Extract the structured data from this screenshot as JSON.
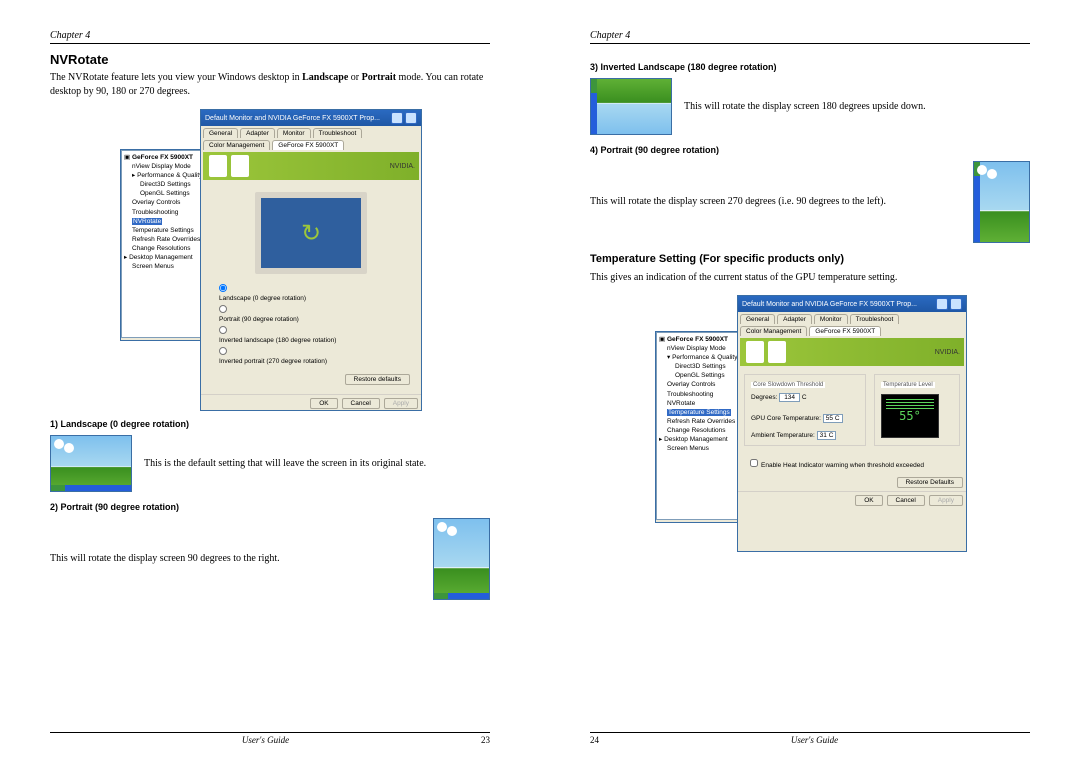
{
  "chapterLabel": "Chapter  4",
  "footerGuide": "User's Guide",
  "left": {
    "pageNum": "23",
    "h2": "NVRotate",
    "intro1a": "The NVRotate feature lets you view your Windows desktop in ",
    "intro1b": "Landscape",
    "intro1c": " or ",
    "intro2a": "Portrait",
    "intro2b": " mode. You can rotate desktop by 90, 180 or 270 degrees.",
    "winTitle": "Default Monitor and NVIDIA GeForce FX 5900XT Prop...",
    "tabs": {
      "general": "General",
      "adapter": "Adapter",
      "monitor": "Monitor",
      "troubleshoot": "Troubleshoot",
      "color": "Color Management",
      "gf": "GeForce FX 5900XT"
    },
    "nvLogo": "NVIDIA.",
    "tree": {
      "root": "GeForce FX 5900XT",
      "i1": "nView Display Mode",
      "i2": "Performance & Quality",
      "i3": "Direct3D Settings",
      "i4": "OpenGL Settings",
      "i5": "Overlay Controls",
      "i6": "Troubleshooting",
      "sel": "NVRotate",
      "i8": "Temperature Settings",
      "i9": "Refresh Rate Overrides",
      "i10": "Change Resolutions",
      "i11": "Desktop Management",
      "i12": "Screen Menus"
    },
    "radios": {
      "r1": "Landscape (0 degree rotation)",
      "r2": "Portrait (90 degree rotation)",
      "r3": "Inverted landscape (180 degree rotation)",
      "r4": "Inverted portrait (270 degree rotation)"
    },
    "restore": "Restore defaults",
    "ok": "OK",
    "cancel": "Cancel",
    "apply": "Apply",
    "sub1": "1)  Landscape (0 degree rotation)",
    "sub1txt": "This is the default setting that will leave the screen in its original state.",
    "sub2": "2)  Portrait (90 degree rotation)",
    "sub2txt": "This will rotate the display screen 90 degrees to the right."
  },
  "right": {
    "pageNum": "24",
    "sub3": "3)  Inverted Landscape (180 degree rotation)",
    "sub3txt": "This will rotate the display screen 180 degrees upside down.",
    "sub4": "4)  Portrait (90 degree rotation)",
    "sub4txt": "This will rotate the display screen 270 degrees (i.e. 90 degrees to the left).",
    "h3": "Temperature Setting (For specific products only)",
    "h3txt": "This gives an indication of the current status of the GPU temperature setting.",
    "winTitle": "Default Monitor and NVIDIA GeForce FX 5900XT Prop...",
    "tree": {
      "root": "GeForce FX 5900XT",
      "i1": "nView Display Mode",
      "i2": "Performance & Quality",
      "i3": "Direct3D Settings",
      "i4": "OpenGL Settings",
      "i5": "Overlay Controls",
      "i6": "Troubleshooting",
      "i7": "NVRotate",
      "sel": "Temperature Settings",
      "i9": "Refresh Rate Overrides",
      "i10": "Change Resolutions",
      "i11": "Desktop Management",
      "i12": "Screen Menus"
    },
    "panel": {
      "grp1": "Core Slowdown Threshold",
      "degLbl": "Degrees:",
      "degVal": "134",
      "degUnit": "C",
      "grp2": "Temperature Level",
      "gpuLbl": "GPU Core Temperature:",
      "gpuVal": "55 C",
      "ambLbl": "Ambient Temperature:",
      "ambVal": "31 C",
      "gauge": "55°",
      "heat": "Enable Heat Indicator warning when threshold exceeded",
      "restore": "Restore Defaults"
    }
  }
}
